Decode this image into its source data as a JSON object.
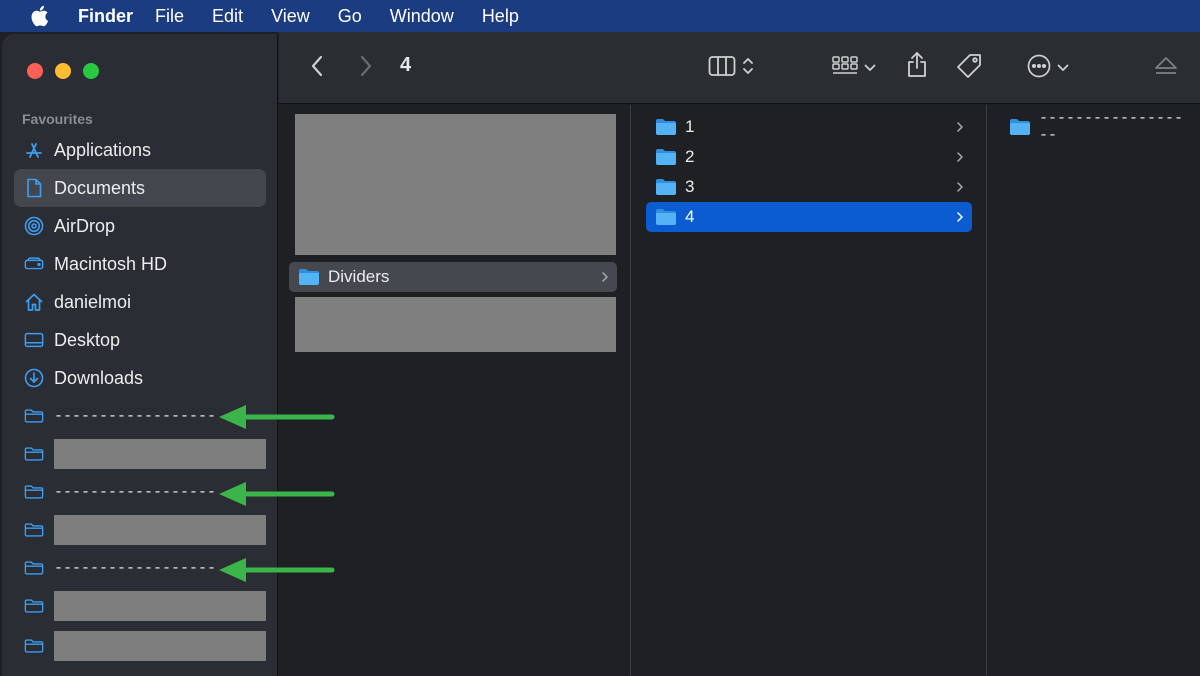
{
  "menubar": {
    "apple_icon": "apple-icon",
    "app_name": "Finder",
    "items": [
      "File",
      "Edit",
      "View",
      "Go",
      "Window",
      "Help"
    ]
  },
  "toolbar": {
    "title": "4",
    "back_icon": "chevron-left-icon",
    "forward_icon": "chevron-right-icon",
    "view_mode_icon": "column-view-icon",
    "group_icon": "group-grid-icon",
    "share_icon": "share-icon",
    "tag_icon": "tag-icon",
    "more_icon": "ellipsis-circle-icon",
    "eject_icon": "eject-icon"
  },
  "sidebar": {
    "section_title": "Favourites",
    "items": [
      {
        "label": "Applications",
        "icon": "applications-icon"
      },
      {
        "label": "Documents",
        "icon": "document-icon",
        "selected": true
      },
      {
        "label": "AirDrop",
        "icon": "airdrop-icon"
      },
      {
        "label": "Macintosh HD",
        "icon": "hard-drive-icon"
      },
      {
        "label": "danielmoi",
        "icon": "home-icon"
      },
      {
        "label": "Desktop",
        "icon": "desktop-icon"
      },
      {
        "label": "Downloads",
        "icon": "download-icon"
      },
      {
        "label": "------------------",
        "icon": "folder-icon"
      },
      {
        "label": "",
        "icon": "folder-icon",
        "redacted": true
      },
      {
        "label": "------------------",
        "icon": "folder-icon"
      },
      {
        "label": "",
        "icon": "folder-icon",
        "redacted": true
      },
      {
        "label": "------------------",
        "icon": "folder-icon"
      },
      {
        "label": "",
        "icon": "folder-icon",
        "redacted": true
      },
      {
        "label": "",
        "icon": "folder-icon",
        "redacted": true
      }
    ]
  },
  "columns": {
    "col1": {
      "folder": "Dividers"
    },
    "col2": {
      "folders": [
        "1",
        "2",
        "3",
        "4"
      ],
      "selected": "4"
    },
    "col3": {
      "folders": [
        "------------------"
      ]
    }
  },
  "annotations": {
    "arrow_color": "#3bb54a"
  },
  "colors": {
    "menubar_bg": "#1c3c82",
    "selection_blue": "#0a5cd0",
    "folder_blue": "#3da1ee"
  }
}
